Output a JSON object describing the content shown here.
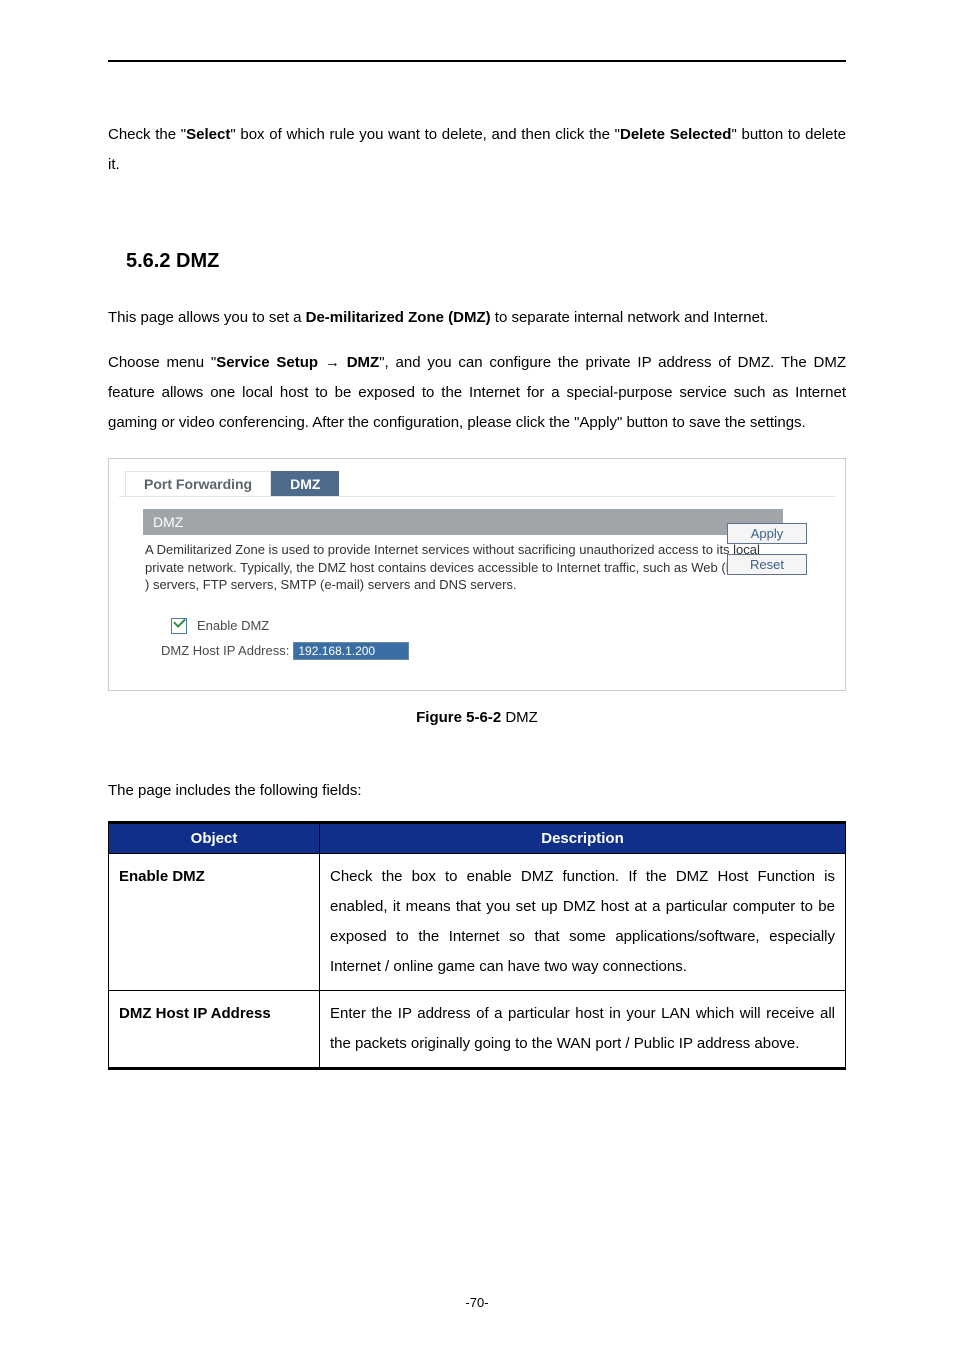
{
  "intro": {
    "pre1": "Check the \"",
    "bold1": "Select",
    "mid1": "\" box of which rule you want to delete, and then click the \"",
    "bold2": "Delete Selected",
    "post1": "\" button to delete it."
  },
  "section": {
    "number_title": "5.6.2  DMZ"
  },
  "para1": {
    "pre": "This page allows you to set a ",
    "bold": "De-militarized Zone (DMZ)",
    "post": " to separate internal network and Internet."
  },
  "para2": {
    "pre": "Choose menu \"",
    "bold1": "Service Setup",
    "arrow": " → ",
    "bold2": "DMZ",
    "post": "\", and you can configure the private IP address of DMZ. The DMZ feature allows one local host to be exposed to the Internet for a special-purpose service such as Internet gaming or video conferencing. After the configuration, please click the \"Apply\" button to save the settings."
  },
  "ui": {
    "tabs": {
      "port_forwarding": "Port Forwarding",
      "dmz": "DMZ"
    },
    "panel_title": "DMZ",
    "panel_desc": "A Demilitarized Zone is used to provide Internet services without sacrificing unauthorized access to its local private network. Typically, the DMZ host contains devices accessible to Internet traffic, such as Web (HTTP ) servers, FTP servers, SMTP (e-mail) servers and DNS servers.",
    "apply": "Apply",
    "reset": "Reset",
    "enable_label": "Enable DMZ",
    "ip_label": "DMZ Host IP Address:",
    "ip_value": "192.168.1.200"
  },
  "caption": {
    "bold": "Figure 5-6-2",
    "rest": " DMZ"
  },
  "fields_intro": "The page includes the following fields:",
  "table": {
    "h1": "Object",
    "h2": "Description",
    "r1o": "Enable DMZ",
    "r1d": "Check the box to enable DMZ function. If the DMZ Host Function is enabled, it means that you set up DMZ host at a particular computer to be exposed to the Internet so that some applications/software, especially Internet / online game can have two way connections.",
    "r2o": "DMZ Host IP Address",
    "r2d": "Enter the IP address of a particular host in your LAN which will receive all the packets originally going to the WAN port / Public IP address above."
  },
  "page_num": "-70-"
}
